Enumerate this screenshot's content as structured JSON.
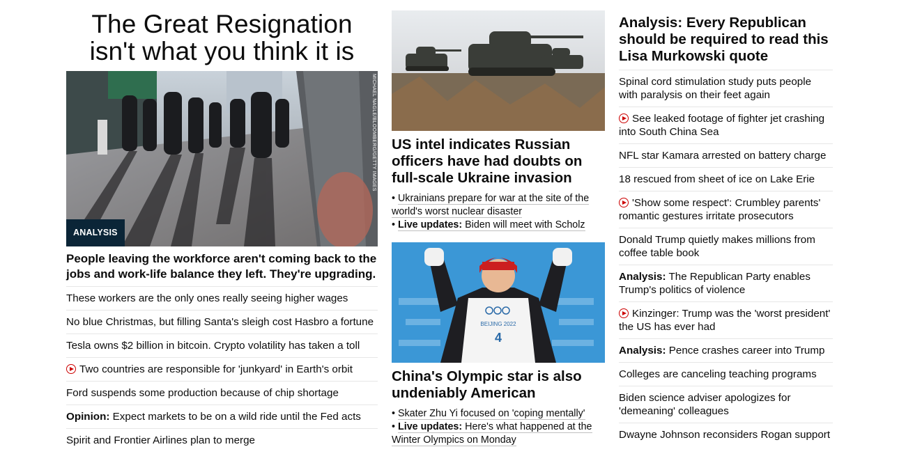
{
  "col1": {
    "hero_title": "The Great Resignation isn't what you think it is",
    "image_badge": "ANALYSIS",
    "image_credit": "MICHAEL NAGLE/BLOOMBERG/GETTY IMAGES",
    "subheadline": "People leaving the workforce aren't coming back to the jobs and work-life balance they left. They're upgrading.",
    "links": [
      {
        "prefix": "",
        "text": "These workers are the only ones really seeing higher wages",
        "video": false
      },
      {
        "prefix": "",
        "text": "No blue Christmas, but filling Santa's sleigh cost Hasbro a fortune",
        "video": false
      },
      {
        "prefix": "",
        "text": "Tesla owns $2 billion in bitcoin. Crypto volatility has taken a toll",
        "video": false
      },
      {
        "prefix": "",
        "text": "Two countries are responsible for 'junkyard' in Earth's orbit",
        "video": true
      },
      {
        "prefix": "",
        "text": "Ford suspends some production because of chip shortage",
        "video": false
      },
      {
        "prefix": "Opinion:",
        "text": "Expect markets to be on a wild ride until the Fed acts",
        "video": false
      },
      {
        "prefix": "",
        "text": "Spirit and Frontier Airlines plan to merge",
        "video": false
      }
    ]
  },
  "col2": {
    "story1": {
      "headline": "US intel indicates Russian officers have had doubts on full-scale Ukraine invasion",
      "bullet1": "Ukrainians prepare for war at the site of the world's worst nuclear disaster",
      "bullet2_prefix": "Live updates:",
      "bullet2_text": "Biden will meet with Scholz"
    },
    "story2": {
      "bib_text": "BEIJING 2022",
      "bib_number": "4",
      "headline": "China's Olympic star is also undeniably American",
      "bullet1": "Skater Zhu Yi focused on 'coping mentally'",
      "bullet2_prefix": "Live updates:",
      "bullet2_text": "Here's what happened at the Winter Olympics on Monday"
    }
  },
  "col3": {
    "headline": "Analysis: Every Republican should be required to read this Lisa Murkowski quote",
    "links": [
      {
        "prefix": "",
        "text": "Spinal cord stimulation study puts people with paralysis on their feet again",
        "video": false
      },
      {
        "prefix": "",
        "text": "See leaked footage of fighter jet crashing into South China Sea",
        "video": true
      },
      {
        "prefix": "",
        "text": "NFL star Kamara arrested on battery charge",
        "video": false
      },
      {
        "prefix": "",
        "text": "18 rescued from sheet of ice on Lake Erie",
        "video": false
      },
      {
        "prefix": "",
        "text": "'Show some respect': Crumbley parents' romantic gestures irritate prosecutors",
        "video": true
      },
      {
        "prefix": "",
        "text": "Donald Trump quietly makes millions from coffee table book",
        "video": false
      },
      {
        "prefix": "Analysis:",
        "text": "The Republican Party enables Trump's politics of violence",
        "video": false
      },
      {
        "prefix": "",
        "text": "Kinzinger: Trump was the 'worst president' the US has ever had",
        "video": true
      },
      {
        "prefix": "Analysis:",
        "text": "Pence crashes career into Trump",
        "video": false
      },
      {
        "prefix": "",
        "text": "Colleges are canceling teaching programs",
        "video": false
      },
      {
        "prefix": "",
        "text": "Biden science adviser apologizes for 'demeaning' colleagues",
        "video": false
      },
      {
        "prefix": "",
        "text": "Dwayne Johnson reconsiders Rogan support",
        "video": false
      }
    ]
  },
  "colors": {
    "video_red": "#cc0000",
    "badge_navy": "#0b2537",
    "divider": "#e6e6e6"
  }
}
